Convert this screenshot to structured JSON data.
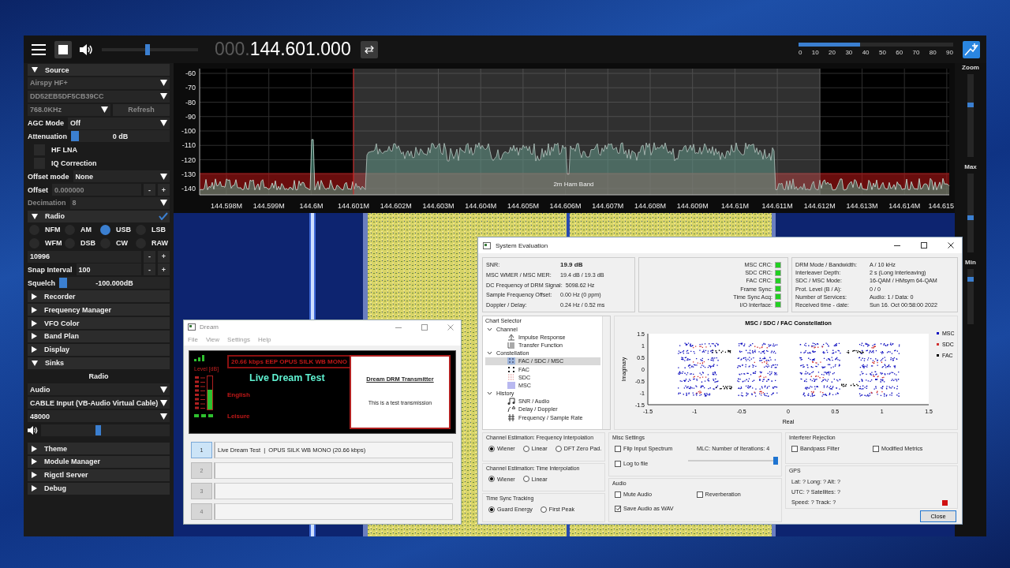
{
  "top_bar": {
    "volume": {
      "level": 0.47
    },
    "frequency_dim": "000.",
    "frequency": "144.601.000",
    "snr_meter": {
      "level": 0.4,
      "scale": [
        "0",
        "10",
        "20",
        "30",
        "40",
        "50",
        "60",
        "70",
        "80",
        "90"
      ]
    }
  },
  "left_panel": {
    "items": [
      {
        "kind": "section",
        "label": "Source",
        "expanded": true
      },
      {
        "kind": "dropdown",
        "value": "Airspy HF+",
        "disabled": true
      },
      {
        "kind": "dropdown",
        "value": "DD52EB5DF5CB39CC",
        "disabled": true
      },
      {
        "kind": "dropdown_button",
        "value": "768.0KHz",
        "button": "Refresh",
        "disabled": true
      },
      {
        "kind": "labeled_dropdown",
        "label": "AGC Mode",
        "value": "Off",
        "disabled": false
      },
      {
        "kind": "slider",
        "label": "Attenuation",
        "level": 0,
        "reading": "0 dB"
      },
      {
        "kind": "checkbox",
        "label": "HF LNA",
        "checked": false
      },
      {
        "kind": "checkbox",
        "label": "IQ Correction",
        "checked": false
      },
      {
        "kind": "labeled_dropdown",
        "label": "Offset mode",
        "value": "None",
        "disabled": false
      },
      {
        "kind": "stepper",
        "label": "Offset",
        "value": "0.000000",
        "minus": "-",
        "plus": "+",
        "disabled": true
      },
      {
        "kind": "labeled_dropdown",
        "label": "Decimation",
        "value": "8",
        "disabled": true
      },
      {
        "kind": "section",
        "label": "Radio",
        "expanded": true,
        "checked": true
      },
      {
        "kind": "radio_grid",
        "options": [
          {
            "label": "NFM",
            "selected": false
          },
          {
            "label": "AM",
            "selected": false
          },
          {
            "label": "USB",
            "selected": true
          },
          {
            "label": "LSB",
            "selected": false
          },
          {
            "label": "WFM",
            "selected": false
          },
          {
            "label": "DSB",
            "selected": false
          },
          {
            "label": "CW",
            "selected": false
          },
          {
            "label": "RAW",
            "selected": false
          }
        ]
      },
      {
        "kind": "stepper",
        "value": "10996",
        "minus": "-",
        "plus": "+",
        "disabled": false
      },
      {
        "kind": "stepper",
        "label": "Snap Interval",
        "value": "100",
        "minus": "-",
        "plus": "+",
        "disabled": false
      },
      {
        "kind": "slider",
        "label": "Squelch",
        "level": 0,
        "reading": "-100.000dB"
      },
      {
        "kind": "section",
        "label": "Recorder",
        "expanded": false
      },
      {
        "kind": "section",
        "label": "Frequency Manager",
        "expanded": false
      },
      {
        "kind": "section",
        "label": "VFO Color",
        "expanded": false
      },
      {
        "kind": "section",
        "label": "Band Plan",
        "expanded": false
      },
      {
        "kind": "section",
        "label": "Display",
        "expanded": false
      },
      {
        "kind": "section",
        "label": "Sinks",
        "expanded": true
      },
      {
        "kind": "heading",
        "label": "Radio"
      },
      {
        "kind": "dropdown",
        "value": "Audio",
        "disabled": false
      },
      {
        "kind": "dropdown",
        "value": "CABLE Input (VB-Audio Virtual Cable)",
        "disabled": false
      },
      {
        "kind": "dropdown",
        "value": "48000",
        "disabled": false
      },
      {
        "kind": "volume",
        "level": 0.44
      },
      {
        "kind": "section",
        "label": "Theme",
        "expanded": false
      },
      {
        "kind": "section",
        "label": "Module Manager",
        "expanded": false
      },
      {
        "kind": "section",
        "label": "Rigctl Server",
        "expanded": false
      },
      {
        "kind": "section",
        "label": "Debug",
        "expanded": false
      }
    ]
  },
  "spectrum": {
    "y_labels": [
      "-60",
      "-70",
      "-80",
      "-90",
      "-100",
      "-110",
      "-120",
      "-130",
      "-140"
    ],
    "x_labels": [
      "144.598M",
      "144.599M",
      "144.6M",
      "144.601M",
      "144.602M",
      "144.603M",
      "144.604M",
      "144.605M",
      "144.606M",
      "144.607M",
      "144.608M",
      "144.609M",
      "144.61M",
      "144.611M",
      "144.612M",
      "144.613M",
      "144.614M",
      "144.615"
    ],
    "band_label": "2m Ham Band"
  },
  "side_controls": [
    {
      "label": "Zoom",
      "level": 0.64
    },
    {
      "label": "Max",
      "level": 0.44
    },
    {
      "label": "Min",
      "level": 0.85
    }
  ],
  "dream_window": {
    "title": "Dream",
    "menu": [
      "File",
      "View",
      "Settings",
      "Help"
    ],
    "quality": "20.66 kbps EEP OPUS SILK WB MONO",
    "level_label": "Level [dB]",
    "meter": {
      "level": 0.6
    },
    "station": "Live Dream Test",
    "language": "English",
    "genre": "Leisure",
    "message_title": "Dream DRM Transmitter",
    "message": "This is a test transmission",
    "services": [
      {
        "number": "1",
        "label": "Live Dream Test  |  OPUS SILK WB MONO (20.66 kbps)",
        "selected": true
      },
      {
        "number": "2",
        "selected": false
      },
      {
        "number": "3",
        "selected": false
      },
      {
        "number": "4",
        "selected": false
      }
    ]
  },
  "system_evaluation": {
    "title": "System Evaluation",
    "signal_stats": [
      {
        "label": "SNR:",
        "value": "19.9 dB"
      },
      {
        "label": "MSC WMER / MSC MER:",
        "value": "19.4 dB / 19.3 dB"
      },
      {
        "label": "DC Frequency of DRM Signal:",
        "value": "5098.62 Hz"
      },
      {
        "label": "Sample Frequency Offset:",
        "value": "0.00 Hz (0 ppm)"
      },
      {
        "label": "Doppler / Delay:",
        "value": "0.24 Hz / 0.52 ms"
      }
    ],
    "crc_status": [
      {
        "label": "MSC CRC:",
        "ok": true
      },
      {
        "label": "SDC CRC:",
        "ok": true
      },
      {
        "label": "FAC CRC:",
        "ok": true
      },
      {
        "label": "Frame Sync:",
        "ok": true
      },
      {
        "label": "Time Sync Acq:",
        "ok": true
      },
      {
        "label": "I/O Interface:",
        "ok": true
      }
    ],
    "drm_info": [
      {
        "label": "DRM Mode / Bandwidth:",
        "value": "A / 10 kHz"
      },
      {
        "label": "Interleaver Depth:",
        "value": "2 s (Long Interleaving)"
      },
      {
        "label": "SDC / MSC Mode:",
        "value": "16-QAM / HMsym 64-QAM"
      },
      {
        "label": "Prot. Level (B / A):",
        "value": "0 / 0"
      },
      {
        "label": "Number of Services:",
        "value": "Audio: 1 / Data: 0"
      },
      {
        "label": "Received time - date:",
        "value": "Sun 16. Oct 00:58:00 2022"
      }
    ],
    "chart_selector": {
      "title": "Chart Selector",
      "tree": [
        {
          "label": "Channel",
          "expanded": true,
          "children": [
            {
              "label": "Impulse Response",
              "selected": false
            },
            {
              "label": "Transfer Function",
              "selected": false
            }
          ]
        },
        {
          "label": "Constellation",
          "expanded": true,
          "children": [
            {
              "label": "FAC / SDC / MSC",
              "selected": true
            },
            {
              "label": "FAC",
              "selected": false
            },
            {
              "label": "SDC",
              "selected": false
            },
            {
              "label": "MSC",
              "selected": false
            }
          ]
        },
        {
          "label": "History",
          "expanded": true,
          "children": [
            {
              "label": "SNR / Audio",
              "selected": false
            },
            {
              "label": "Delay / Doppler",
              "selected": false
            },
            {
              "label": "Frequency / Sample Rate",
              "selected": false
            }
          ]
        }
      ]
    },
    "constellation": {
      "title": "MSC / SDC / FAC Constellation",
      "xlabel": "Real",
      "ylabel": "Imaginary",
      "x_ticks": [
        "-1.5",
        "-1",
        "-0.5",
        "0",
        "0.5",
        "1",
        "1.5"
      ],
      "y_ticks": [
        "1.5",
        "1",
        "0.5",
        "0",
        "-0.5",
        "-1",
        "-1.5"
      ],
      "legend": [
        {
          "label": "MSC",
          "color": "#1010c0"
        },
        {
          "label": "SDC",
          "color": "#d03030"
        },
        {
          "label": "FAC",
          "color": "#000000"
        }
      ]
    },
    "settings_columns": [
      {
        "groups": [
          {
            "kind": "radios",
            "title": "Channel Estimation: Frequency Interpolation",
            "options": [
              {
                "label": "Wiener",
                "selected": true
              },
              {
                "label": "Linear",
                "selected": false
              },
              {
                "label": "DFT Zero Pad.",
                "selected": false
              }
            ]
          },
          {
            "kind": "radios",
            "title": "Channel Estimation: Time Interpolation",
            "options": [
              {
                "label": "Wiener",
                "selected": true
              },
              {
                "label": "Linear",
                "selected": false
              }
            ]
          },
          {
            "kind": "radios",
            "title": "Time Sync Tracking",
            "options": [
              {
                "label": "Guard Energy",
                "selected": true
              },
              {
                "label": "First Peak",
                "selected": false
              }
            ]
          }
        ]
      },
      {
        "groups": [
          {
            "kind": "misc",
            "title": "Misc Settings",
            "checks": [
              {
                "label": "Flip Input Spectrum",
                "checked": false
              },
              {
                "label": "Log to file",
                "checked": false
              }
            ],
            "slider_label": "MLC: Number of Iterations: 4",
            "level": 1
          },
          {
            "kind": "checks",
            "title": "Audio",
            "checks": [
              {
                "label": "Mute Audio",
                "checked": false
              },
              {
                "label": "Reverberation",
                "checked": false
              },
              {
                "label": "Save Audio as WAV",
                "checked": true
              }
            ]
          }
        ]
      },
      {
        "groups": [
          {
            "kind": "checks",
            "title": "Interferer Rejection",
            "checks": [
              {
                "label": "Bandpass Filter",
                "checked": false
              },
              {
                "label": "Modified Metrics",
                "checked": false
              }
            ]
          },
          {
            "kind": "gps",
            "title": "GPS",
            "lines": [
              "Lat: ?  Long: ?  Alt: ?",
              "UTC: ?  Satellites: ?",
              "Speed: ?  Track: ?"
            ],
            "fix": false
          }
        ]
      }
    ],
    "close_button": "Close"
  }
}
